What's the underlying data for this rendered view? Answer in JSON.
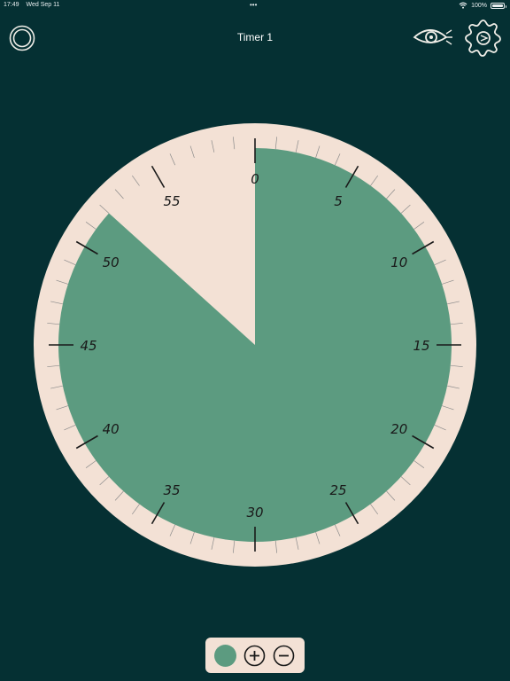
{
  "status_bar": {
    "time": "17:49",
    "date": "Wed Sep 11",
    "battery": "100%"
  },
  "header": {
    "title": "Timer 1"
  },
  "icons": {
    "left": "circle-icon",
    "eye": "eye-icon",
    "settings": "gear-icon",
    "plus": "plus-icon",
    "minus": "minus-icon"
  },
  "timer": {
    "remaining_minutes": 52,
    "total_minutes": 60,
    "labels": [
      "0",
      "5",
      "10",
      "15",
      "20",
      "25",
      "30",
      "35",
      "40",
      "45",
      "50",
      "55"
    ]
  },
  "colors": {
    "background": "#053033",
    "dial_face": "#f3e1d5",
    "timer_fill": "#5c9b80",
    "ticks": "#1a1a1a"
  }
}
